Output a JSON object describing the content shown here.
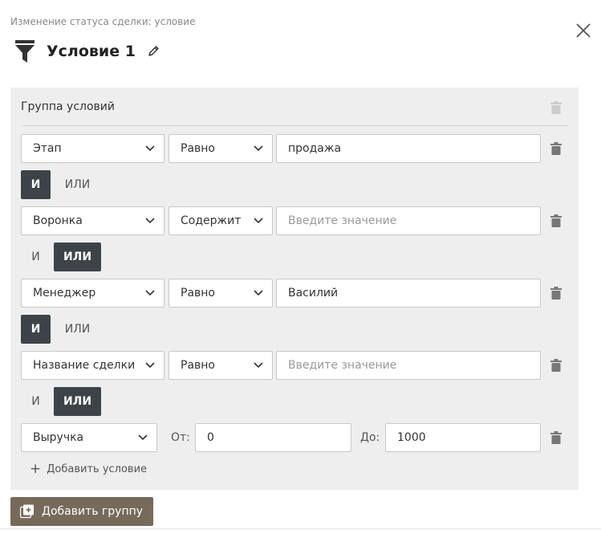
{
  "header": {
    "subtitle": "Изменение статуса сделки: условие",
    "title": "Условие 1"
  },
  "group": {
    "title": "Группа условий"
  },
  "conditions": [
    {
      "field": "Этап",
      "operator": "Равно",
      "value": "продажа",
      "placeholder": ""
    },
    {
      "field": "Воронка",
      "operator": "Содержит",
      "value": "",
      "placeholder": "Введите значение"
    },
    {
      "field": "Менеджер",
      "operator": "Равно",
      "value": "Василий",
      "placeholder": ""
    },
    {
      "field": "Название сделки",
      "operator": "Равно",
      "value": "",
      "placeholder": "Введите значение"
    },
    {
      "field": "Выручка",
      "from_label": "От:",
      "from_value": "0",
      "to_label": "До:",
      "to_value": "1000"
    }
  ],
  "logic": [
    {
      "and_label": "И",
      "or_label": "ИЛИ",
      "selected": "and"
    },
    {
      "and_label": "И",
      "or_label": "ИЛИ",
      "selected": "or"
    },
    {
      "and_label": "И",
      "or_label": "ИЛИ",
      "selected": "and"
    },
    {
      "and_label": "И",
      "or_label": "ИЛИ",
      "selected": "or"
    }
  ],
  "actions": {
    "add_condition": "Добавить условие",
    "add_group": "Добавить группу"
  },
  "colors": {
    "panel": "#eeeeee",
    "active_logic": "#3d4349",
    "add_group_button": "#766a5b"
  },
  "icons": [
    "filter-icon",
    "pencil-icon",
    "close-icon",
    "trash-icon",
    "chevron-down-icon",
    "plus-icon",
    "add-group-icon"
  ]
}
